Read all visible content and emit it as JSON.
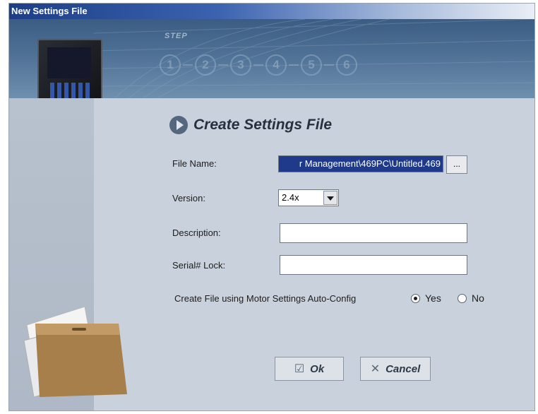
{
  "window": {
    "title": "New Settings File"
  },
  "banner": {
    "step_label": "STEP",
    "steps": [
      "1",
      "2",
      "3",
      "4",
      "5",
      "6"
    ]
  },
  "dialog": {
    "heading": "Create Settings File",
    "file_name_label": "File Name:",
    "file_name_value": "r Management\\469PC\\Untitled.469",
    "browse_label": "...",
    "version_label": "Version:",
    "version_value": "2.4x",
    "description_label": "Description:",
    "description_value": "",
    "serial_lock_label": "Serial# Lock:",
    "serial_lock_value": "",
    "autoconfig_label": "Create File using Motor Settings Auto-Config",
    "yes_label": "Yes",
    "no_label": "No",
    "autoconfig_selected": "Yes",
    "ok_label": "Ok",
    "cancel_label": "Cancel"
  },
  "icons": {
    "heading": "arrow-circle-icon",
    "ok": "checkbox-icon",
    "cancel": "x-icon"
  }
}
